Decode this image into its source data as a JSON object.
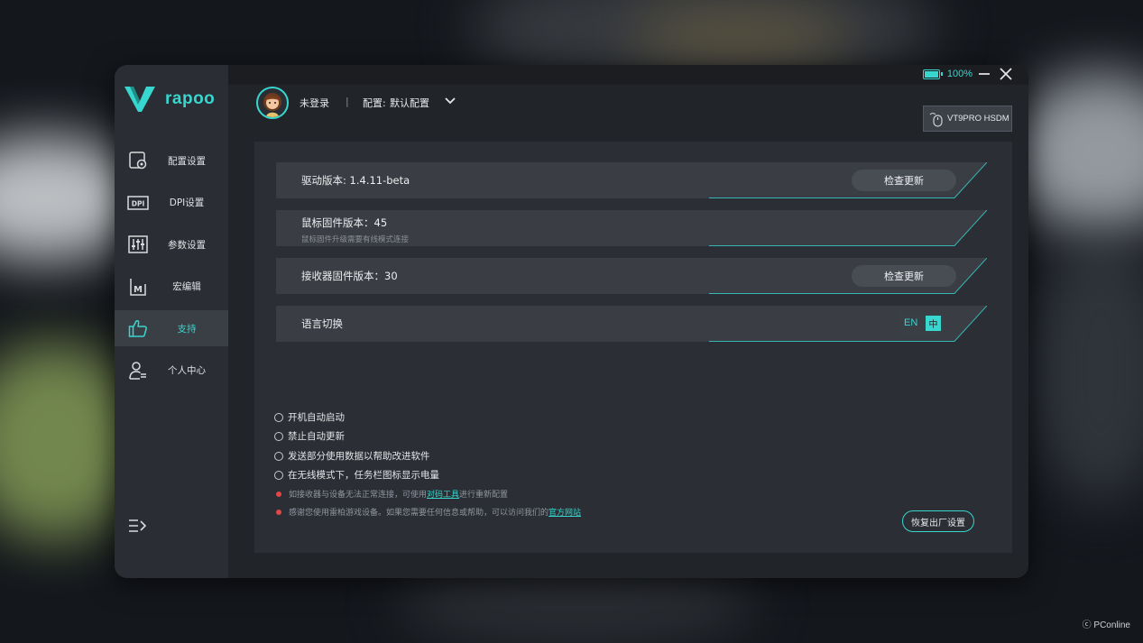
{
  "app": {
    "brand": "rapoo",
    "accent": "#37d6cf",
    "warning": "#e04848"
  },
  "status": {
    "battery": "100%",
    "battery_level": 1.0
  },
  "sidebar": {
    "items": [
      {
        "label": "配置设置",
        "icon": "profile-settings-icon"
      },
      {
        "label": "DPI设置",
        "icon": "dpi-icon"
      },
      {
        "label": "参数设置",
        "icon": "sliders-icon"
      },
      {
        "label": "宏编辑",
        "icon": "macro-icon"
      },
      {
        "label": "支持",
        "icon": "thumbs-up-icon",
        "active": true
      },
      {
        "label": "个人中心",
        "icon": "user-icon"
      }
    ]
  },
  "header": {
    "login": "未登录",
    "separator": "|",
    "profile_label": "配置:",
    "profile_value": "默认配置",
    "device": "VT9PRO HSDM"
  },
  "rows": {
    "driver": {
      "text": "驱动版本: 1.4.11-beta",
      "button": "检查更新"
    },
    "mouse_fw": {
      "text": "鼠标固件版本：45",
      "sub": "鼠标固件升级需要有线模式连接"
    },
    "receiver_fw": {
      "text": "接收器固件版本：30",
      "button": "检查更新"
    },
    "language": {
      "text": "语言切换",
      "en": "EN",
      "zh": "中"
    }
  },
  "options": [
    "开机自动启动",
    "禁止自动更新",
    "发送部分使用数据以帮助改进软件",
    "在无线模式下，任务栏图标显示电量"
  ],
  "notes": {
    "pair": {
      "before": "如接收器与设备无法正常连接，可使用",
      "link": "对码工具",
      "after": "进行重新配置"
    },
    "site": {
      "before": "感谢您使用雷柏游戏设备。如果您需要任何信息或帮助，可以访问我们的",
      "link": "官方网站"
    }
  },
  "reset_button": "恢复出厂设置",
  "watermark": "PConline"
}
